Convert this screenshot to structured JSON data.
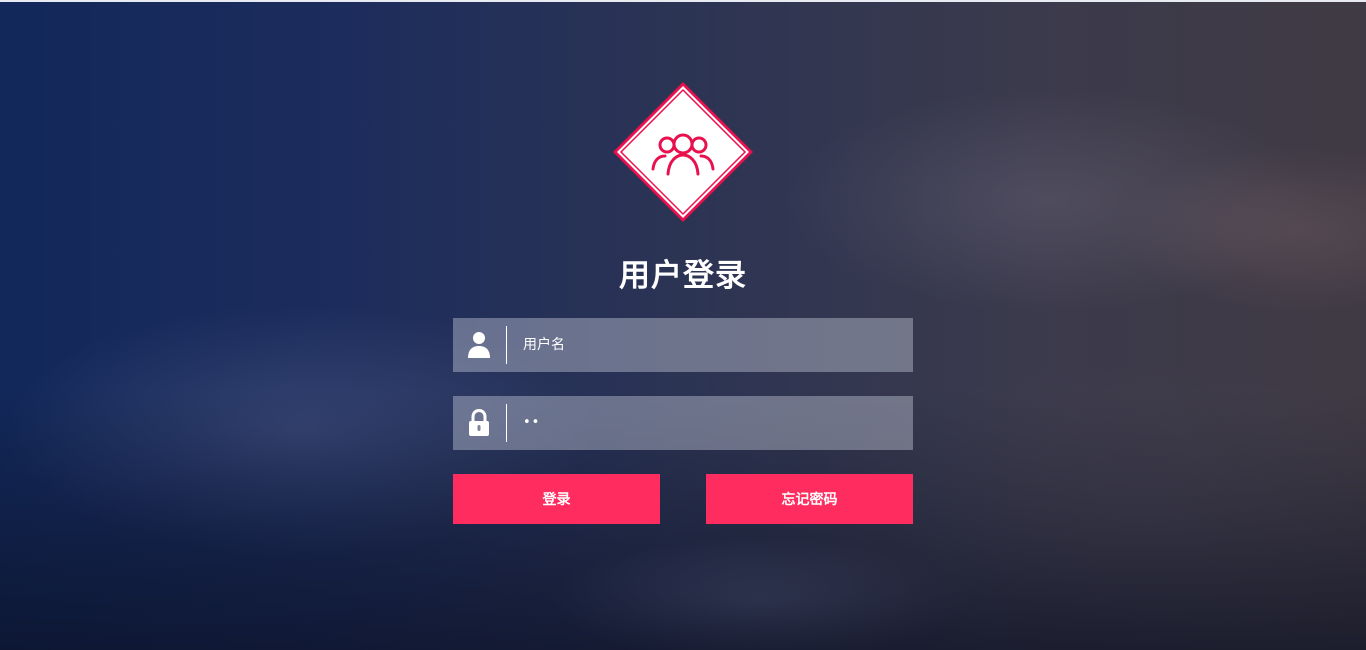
{
  "page": {
    "title": "用户登录"
  },
  "logo": {
    "icon": "users-group-icon",
    "accent_color": "#e8114e"
  },
  "form": {
    "username": {
      "icon": "user-icon",
      "placeholder": "用户名",
      "value": ""
    },
    "password": {
      "icon": "lock-icon",
      "masked_value": "••"
    },
    "login_button": "登录",
    "forgot_button": "忘记密码"
  },
  "colors": {
    "button": "#fe2c5f",
    "text": "#ffffff"
  }
}
